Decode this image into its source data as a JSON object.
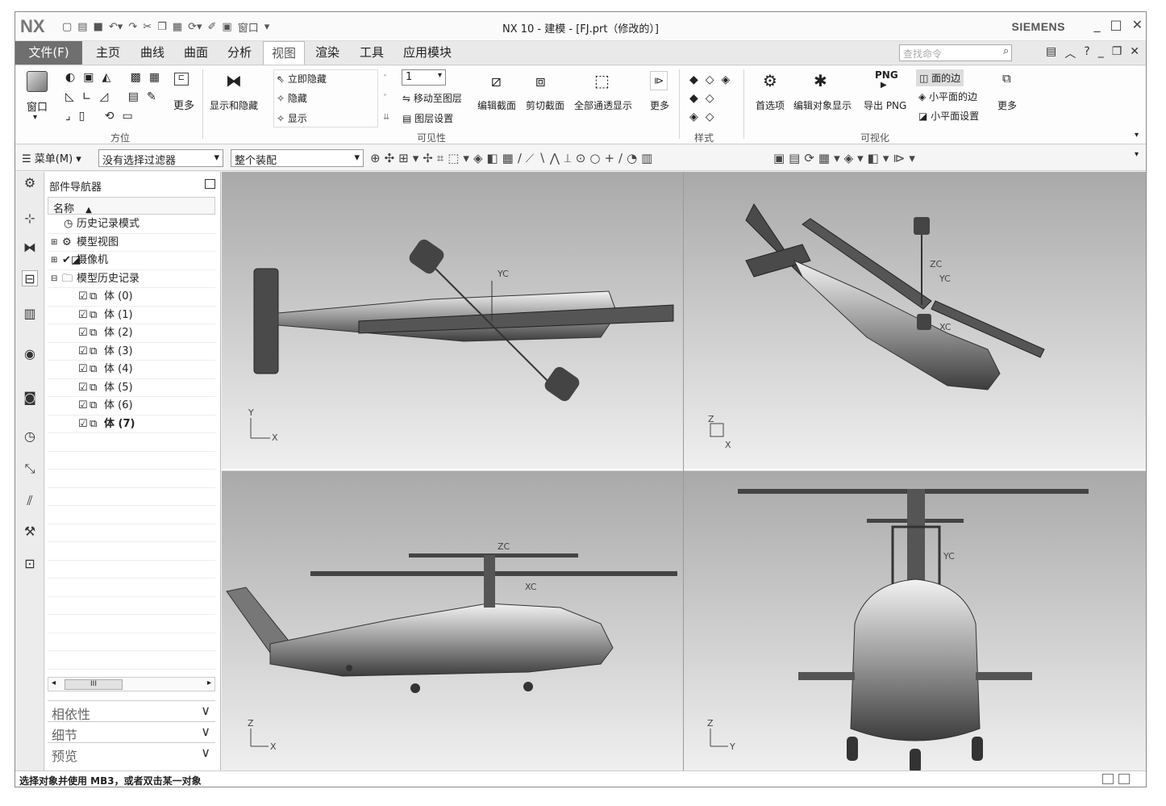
{
  "app": {
    "logo": "NX",
    "title": "NX 10 - 建模 - [FJ.prt（修改的）]",
    "brand": "SIEMENS",
    "quick_window": "窗口"
  },
  "menu": {
    "file": "文件(F)",
    "tabs": [
      "主页",
      "曲线",
      "曲面",
      "分析",
      "视图",
      "渲染",
      "工具",
      "应用模块"
    ],
    "active_tab": "视图",
    "find_placeholder": "查找命令"
  },
  "ribbon": {
    "window": "窗口",
    "orient_group": "方位",
    "more1": "更多",
    "show_hide": "显示和隐藏",
    "hide_immediate": "立即隐藏",
    "hide": "隐藏",
    "show": "显示",
    "layer_value": "1",
    "move_to_layer": "移动至图层",
    "layer_settings": "图层设置",
    "visibility_group": "可见性",
    "edit_section": "编辑截面",
    "clip_section": "剪切截面",
    "all_transparent": "全部通透显示",
    "more2": "更多",
    "style_group": "样式",
    "preferences": "首选项",
    "edit_object_display": "编辑对象显示",
    "export_png": "导出 PNG",
    "png": "PNG",
    "face_edges": "面的边",
    "facet_edges": "小平面的边",
    "facet_settings": "小平面设置",
    "more3": "更多",
    "visualization_group": "可视化"
  },
  "toolbar": {
    "menu": "菜单(M)",
    "filter": "没有选择过滤器",
    "scope": "整个装配"
  },
  "navigator": {
    "title": "部件导航器",
    "column": "名称",
    "items": [
      {
        "label": "历史记录模式",
        "indent": 1
      },
      {
        "label": "模型视图",
        "indent": 0
      },
      {
        "label": "摄像机",
        "indent": 0
      },
      {
        "label": "模型历史记录",
        "indent": 0
      },
      {
        "label": "体 (0)",
        "indent": 2
      },
      {
        "label": "体 (1)",
        "indent": 2
      },
      {
        "label": "体 (2)",
        "indent": 2
      },
      {
        "label": "体 (3)",
        "indent": 2
      },
      {
        "label": "体 (4)",
        "indent": 2
      },
      {
        "label": "体 (5)",
        "indent": 2
      },
      {
        "label": "体 (6)",
        "indent": 2
      },
      {
        "label": "体 (7)",
        "indent": 2,
        "bold": true
      }
    ],
    "scroll_thumb": "III",
    "sections": [
      "相依性",
      "细节",
      "预览"
    ]
  },
  "viewport": {
    "views": [
      {
        "name": "top",
        "axis_labels": [
          "Y",
          "X"
        ],
        "wcs_labels": [
          "YC"
        ]
      },
      {
        "name": "isometric",
        "axis_labels": [
          "Z",
          "X"
        ],
        "wcs_labels": [
          "ZC",
          "YC",
          "XC"
        ]
      },
      {
        "name": "front",
        "axis_labels": [
          "Z",
          "X"
        ],
        "wcs_labels": [
          "ZC",
          "XC"
        ]
      },
      {
        "name": "right",
        "axis_labels": [
          "Z",
          "Y"
        ],
        "wcs_labels": [
          "YC"
        ]
      }
    ]
  },
  "status": {
    "prompt": "选择对象并使用 MB3，或者双击某一对象"
  }
}
